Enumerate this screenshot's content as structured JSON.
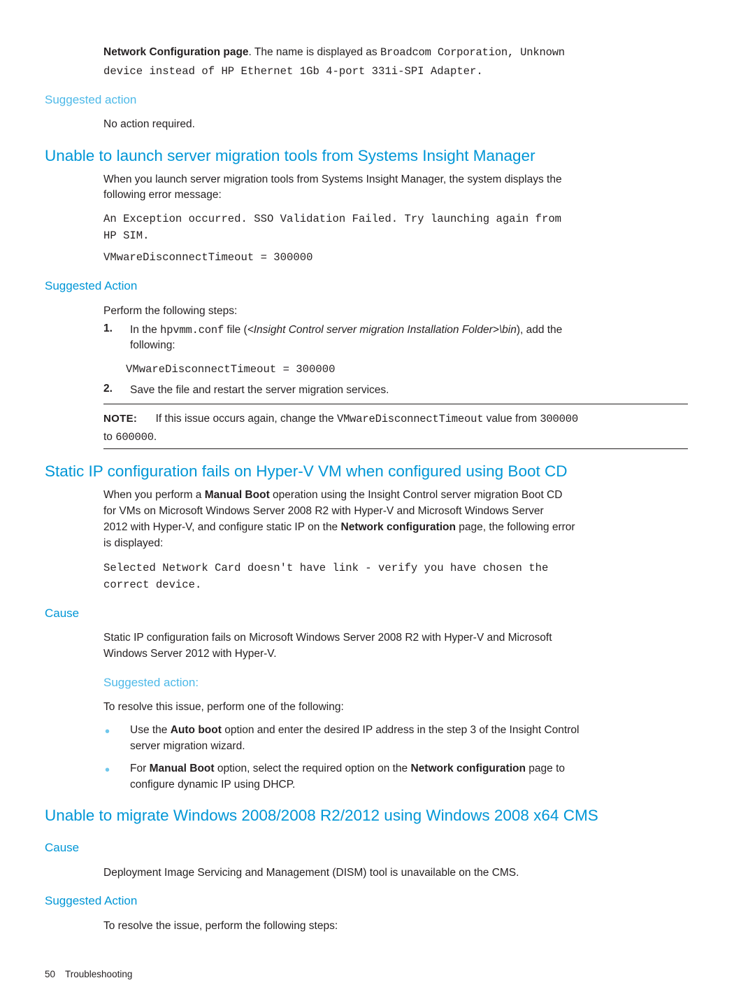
{
  "page": {
    "footer_page_number": "50",
    "footer_chapter": "Troubleshooting",
    "accent_color": "#0096d6",
    "accent_light": "#4db9e8",
    "bullet_color": "#6fc7ec"
  },
  "intro": {
    "lead_bold": "Network Configuration page",
    "lead_rest": ". The name is displayed as ",
    "mono_1": "Broadcom Corporation, Unknown",
    "mono_2": "device instead of HP Ethernet 1Gb 4-port 331i-SPI Adapter.",
    "suggested_action_heading": "Suggested action",
    "suggested_action_text": "No action required."
  },
  "section_sim": {
    "heading": "Unable to launch server migration tools from Systems Insight Manager",
    "para_1": "When you launch server migration tools from Systems Insight Manager, the system displays the",
    "para_2": "following error message:",
    "code_1": "An Exception occurred. SSO Validation Failed. Try launching again from",
    "code_2": "HP SIM.",
    "code_3": "VMwareDisconnectTimeout = 300000",
    "suggested_action_heading": "Suggested Action",
    "perform_steps": "Perform the following steps:",
    "steps": [
      {
        "marker": "1.",
        "pre": "In the ",
        "mono": "hpvmm.conf",
        "mid": " file (",
        "ital": "<Insight Control server migration Installation Folder>\\bin",
        "post": "), add the",
        "line2": "following:"
      },
      {
        "marker": "2.",
        "pre": "Save the file and restart the server migration services.",
        "mono": "",
        "mid": "",
        "ital": "",
        "post": "",
        "line2": ""
      }
    ],
    "step_code": "VMwareDisconnectTimeout = 300000",
    "note_label": "NOTE:",
    "note_text_1": "If this issue occurs again, change the ",
    "note_mono_1": "VMwareDisconnectTimeout",
    "note_text_2": " value from ",
    "note_mono_2": "300000",
    "note_text_3": "to ",
    "note_mono_3": "600000",
    "note_text_4": "."
  },
  "section_staticip": {
    "heading": "Static IP configuration fails on Hyper-V VM when configured using Boot CD",
    "para_line1_a": "When you perform a ",
    "para_line1_b": "Manual Boot",
    "para_line1_c": " operation using the Insight Control server migration Boot CD",
    "para_line2": "for VMs on Microsoft Windows Server 2008 R2 with Hyper-V and Microsoft Windows Server",
    "para_line3_a": "2012 with Hyper-V, and configure static IP on the ",
    "para_line3_b": "Network configuration",
    "para_line3_c": " page, the following error",
    "para_line4": "is displayed:",
    "code_1": "Selected Network Card doesn't have link - verify you have chosen the",
    "code_2": "correct device.",
    "cause_heading": "Cause",
    "cause_line1": "Static IP configuration fails on Microsoft Windows Server 2008 R2 with Hyper-V and Microsoft",
    "cause_line2": "Windows Server 2012 with Hyper-V.",
    "suggested_action_heading": "Suggested action:",
    "resolve_text": "To resolve this issue, perform one of the following:",
    "bullets": [
      {
        "a": "Use the ",
        "b": "Auto boot",
        "c": " option and enter the desired IP address in the step 3 of the Insight Control",
        "line2": "server migration wizard."
      },
      {
        "a": "For ",
        "b": "Manual Boot",
        "c": " option, select the required option on the ",
        "b2": "Network configuration",
        "c2": " page to",
        "line2": "configure dynamic IP using DHCP."
      }
    ]
  },
  "section_migrate": {
    "heading": "Unable to migrate Windows 2008/2008 R2/2012 using Windows 2008 x64 CMS",
    "cause_heading": "Cause",
    "cause_text": "Deployment Image Servicing and Management (DISM) tool is unavailable on the CMS.",
    "suggested_action_heading": "Suggested Action",
    "resolve_text": "To resolve the issue, perform the following steps:"
  }
}
